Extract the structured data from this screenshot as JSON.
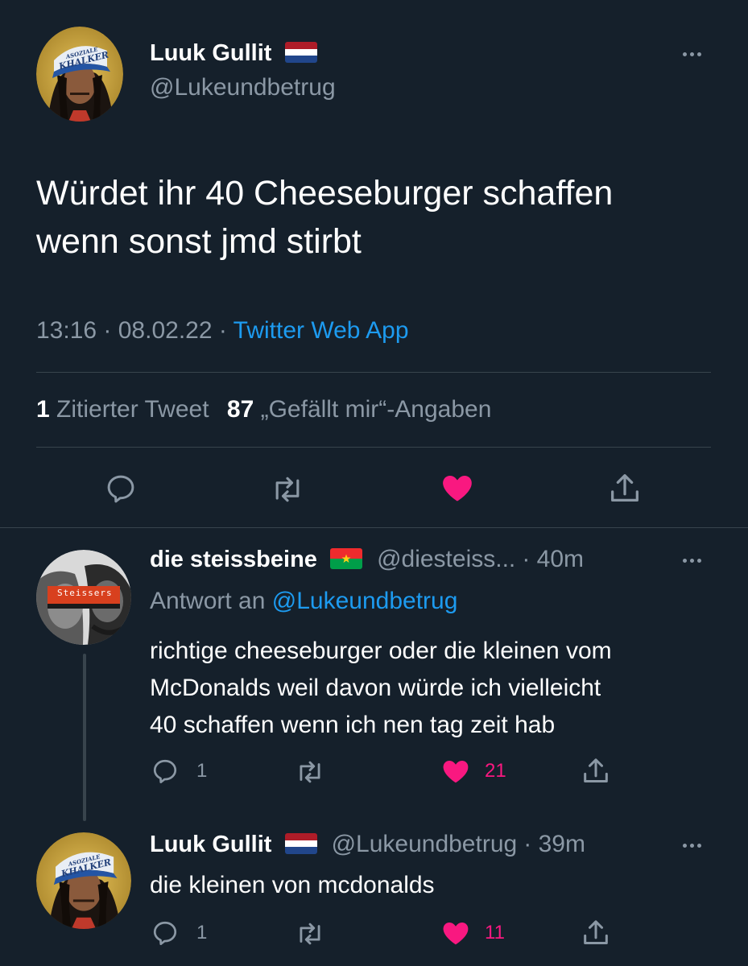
{
  "main_tweet": {
    "author_name": "Luuk Gullit",
    "author_handle": "@Lukeundbetrug",
    "text_line1": "Würdet ihr 40 Cheeseburger schaffen",
    "text_line2": "wenn sonst jmd stirbt",
    "time": "13:16",
    "separator1": " · ",
    "date": "08.02.22",
    "separator2": " · ",
    "source": "Twitter Web App",
    "quote_count": "1",
    "quote_label": "Zitierter Tweet",
    "like_count": "87",
    "like_label": "„Gefällt mir“-Angaben",
    "avatar_cap_text_1": "ASOZIALE",
    "avatar_cap_text_2": "KHALKER",
    "liked": true
  },
  "reply1": {
    "author_name": "die steissbeine",
    "author_handle": "@diesteiss...",
    "time": "· 40m",
    "reply_to_label": "Antwort an",
    "reply_to_handle": "@Lukeundbetrug",
    "text_line1": "richtige cheeseburger oder die kleinen vom",
    "text_line2": "McDonalds weil davon würde ich vielleicht",
    "text_line3": "40 schaffen wenn ich nen tag zeit hab",
    "reply_count": "1",
    "like_count": "21",
    "avatar_banner_text": "Steissers",
    "liked": true
  },
  "reply2": {
    "author_name": "Luuk Gullit",
    "author_handle": "@Lukeundbetrug",
    "time": "· 39m",
    "text_line1": "die kleinen von mcdonalds",
    "reply_count": "1",
    "like_count": "11",
    "liked": true
  },
  "colors": {
    "background": "#15202b",
    "muted": "#8b98a5",
    "link": "#1d9bf0",
    "like": "#f91880",
    "divider": "#38444d"
  },
  "icons": {
    "reply": "reply-icon",
    "retweet": "retweet-icon",
    "like": "heart-icon",
    "share": "share-icon",
    "more": "more-icon"
  }
}
